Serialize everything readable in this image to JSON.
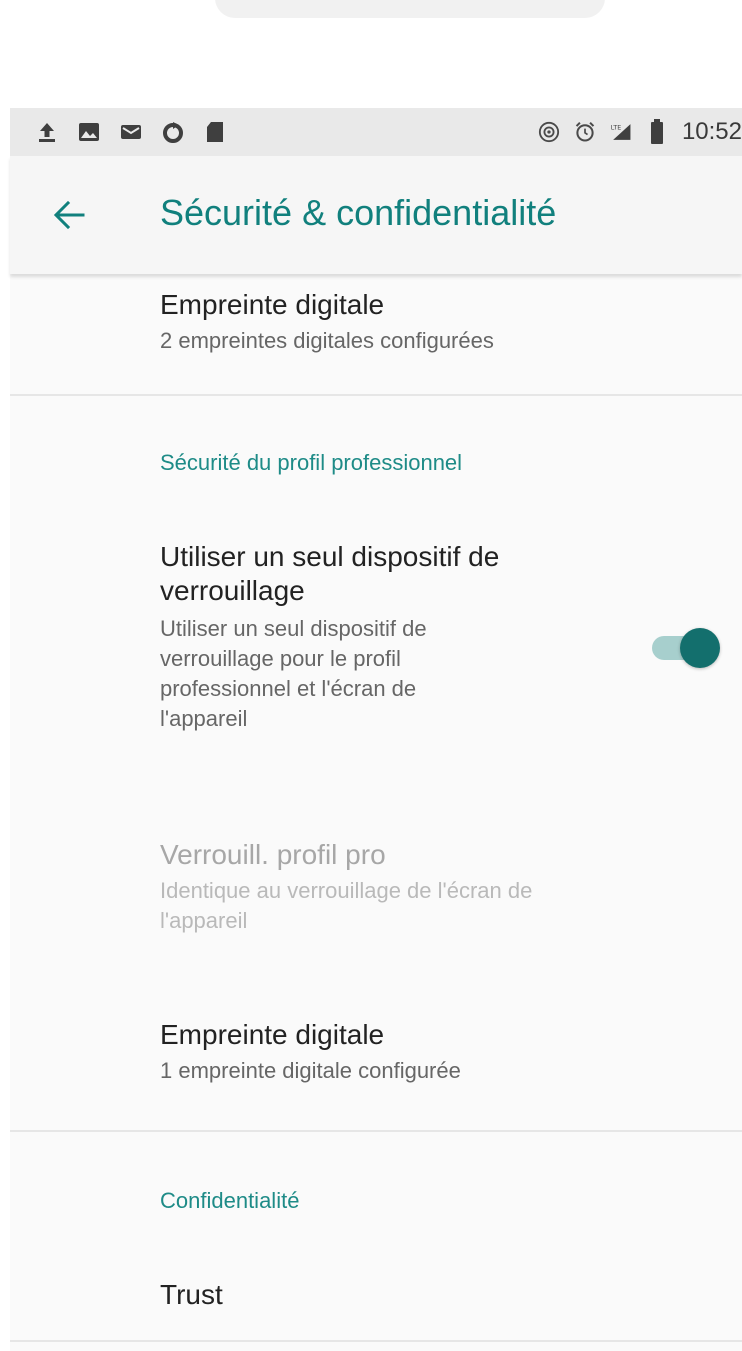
{
  "status_bar": {
    "time": "10:52",
    "icons_left": [
      "upload-icon",
      "image-icon",
      "email-icon",
      "sync-icon",
      "sd-card-icon"
    ],
    "icons_right": [
      "hotspot-icon",
      "alarm-icon",
      "signal-lte-icon",
      "battery-icon"
    ]
  },
  "app_bar": {
    "back_icon": "arrow-left-icon",
    "title": "Sécurité & confidentialité"
  },
  "sections": {
    "fingerprint_top": {
      "title": "Empreinte digitale",
      "subtitle": "2 empreintes digitales configurées"
    },
    "work_profile_header": "Sécurité du profil professionnel",
    "single_lock": {
      "title_line1": "Utiliser un seul dispositif de",
      "title_line2": "verrouillage",
      "desc_line1": "Utiliser un seul dispositif de",
      "desc_line2": "verrouillage pour le profil",
      "desc_line3": "professionnel et l'écran de",
      "desc_line4": "l'appareil",
      "toggle_on": true
    },
    "work_lock": {
      "title": "Verrouill. profil pro",
      "desc_line1": "Identique au verrouillage de l'écran de",
      "desc_line2": "l'appareil"
    },
    "fingerprint_work": {
      "title": "Empreinte digitale",
      "subtitle": "1 empreinte digitale configurée"
    },
    "privacy_header": "Confidentialité",
    "trust": {
      "title": "Trust"
    }
  },
  "colors": {
    "accent": "#1e8b87",
    "toggle_thumb": "#136f6d",
    "toggle_track": "#a7cfcd",
    "status_bar": "#e9e9e9"
  }
}
